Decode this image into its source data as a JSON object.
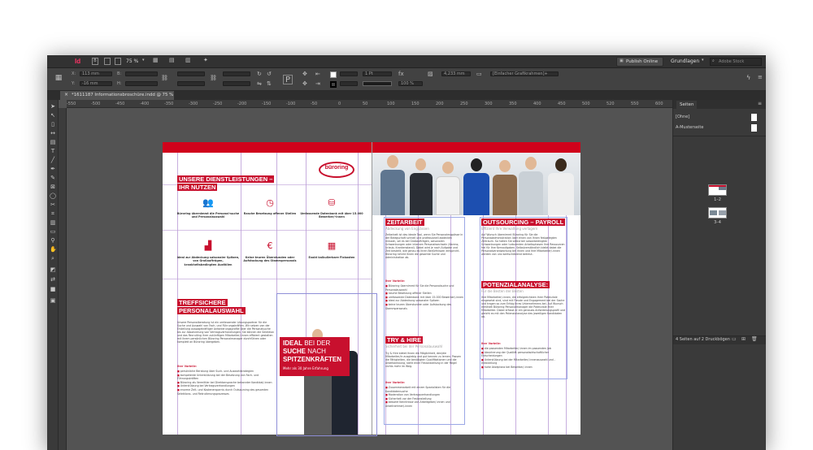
{
  "app": {
    "app_logo": "Id",
    "zoom": "75 %",
    "publish_label": "Publish Online",
    "workspace": "Grundlagen",
    "search_placeholder": "Adobe Stock"
  },
  "control_bar": {
    "x_value": "113 mm",
    "y_value": "-16 mm",
    "stroke_weight": "1 Pt",
    "opacity": "100 %",
    "size_value": "4,233 mm",
    "frame_style": "[Einfacher Grafikrahmen]+"
  },
  "document_tab": {
    "title": "*1611187 Informationsbroschüre.indd @ 75 %",
    "close": "×"
  },
  "ruler": {
    "ticks": [
      "-550",
      "-500",
      "-450",
      "-400",
      "-350",
      "-300",
      "-250",
      "-200",
      "-150",
      "-100",
      "-50",
      "0",
      "50",
      "100",
      "150",
      "200",
      "250",
      "300",
      "350",
      "400",
      "450",
      "500",
      "520",
      "550",
      "600"
    ]
  },
  "pages_panel": {
    "tab_label": "Seiten",
    "none_master": "[Ohne]",
    "a_master": "A-Musterseite",
    "spread1_label": "1–2",
    "spread2_label": "3–4",
    "status": "4 Seiten auf 2 Druckbögen"
  },
  "left_page": {
    "logo": "büroring",
    "services_heading_1": "UNSERE DIENSTLEISTUNGEN –",
    "services_heading_2": "IHR NUTZEN",
    "services": [
      {
        "icon": "people-icon",
        "text": "Büroring übernimmt die Personal-suche und Personalauswahl"
      },
      {
        "icon": "clock-icon",
        "text": "Rasche Besetzung offener Stellen"
      },
      {
        "icon": "database-icon",
        "text": "Umfassende Datenbank mit über 15.000 Bewerber/-innen"
      },
      {
        "icon": "bar-chart-icon",
        "text": "Ideal zur Abdeckung saisonaler Spitzen, von Großaufträgen, krankheitsbedingten Ausfällen"
      },
      {
        "icon": "no-euro-icon",
        "text": "Keine teuren Überstunden oder Aufstockung des Stammpersonals"
      },
      {
        "icon": "calculator-icon",
        "text": "Exakt kalkulierbare Fixkosten"
      }
    ],
    "selection_heading_1": "TREFFSICHERE",
    "selection_heading_2": "PERSONALAUSWAHL",
    "selection_body": "Unsere Personalberatung ist ein umfassender Lösungspartner für die Suche und Auswahl von Fach- und Führungskräften. Wir setzen von der Erstellung aussagekräftiger Anforderungsprofile über die Personalsuche bis zur Absolvierung von Vertragsverhandlungen. Sie können die Selektion und das Recruiting ihrer zukünftigen Mitarbeiter/-innen effizient gestalten mit ihrem persönlichen Büroring Personalmanager durchführen oder komplett an Büroring übergeben.",
    "vorteil_label": "Ihre Vorteile:",
    "selection_bullets": [
      "persönliche Beratung über Such- und Auswahlstrategien",
      "kompetente Unterstützung bei der Besetzung von Fach- und Führungskräften",
      "Büroring als Vermittler bei Direktansprache bekannter Kandidat/-innen",
      "Unterstützung bei Vertragsverhandlungen",
      "enorme Zeit- und Kostenersparnis durch Outsourcing des gesamten Selektions- und Rekrutierungsprozesses"
    ],
    "banner_line1_strong": "IDEAL",
    "banner_line1_rest": " BEI DER",
    "banner_line2_strong": "SUCHE",
    "banner_line2_rest": " NACH",
    "banner_line3": "SPITZENKRÄFTEN",
    "banner_tag": "Mehr als 30 Jahre Erfahrung"
  },
  "right_page": {
    "zeitarbeit_heading": "ZEITARBEIT",
    "zeitarbeit_sub": "Abdeckung von Engpässen",
    "zeitarbeit_body": "Zeitarbeit ist das ideale Tool, wenn Sie Personalengpässe in der Belegschaft schnell und professionell abdecken müssen, sei es bei Großaufträgen, saisonalen Schwankungen oder internen Personalwechseln (Karenz, Urlaub, Krankenstand). Dabei wird je nach Aufgabe und Zeit bestellt, wie genau es Ihren Bedürfnissen entspricht. Büroring nimmt Ihnen die gesamte Suche und Administration ab.",
    "zeitarbeit_vorteil": "Ihre Vorteile:",
    "zeitarbeit_bullets": [
      "Büroring übernimmt für Sie die Personalsuche und Personalauswahl",
      "rasche Besetzung offener Stellen",
      "umfassende Datenbank mit über 15.000 Bewerber/-innen",
      "ideal zur Abdeckung saisonaler Spitzen",
      "keine teuren Überstunden oder Aufstockung des Stammpersonals"
    ],
    "tryhire_heading": "TRY & HIRE",
    "tryhire_sub": "Sicherheit bei der Personalauswahl",
    "tryhire_body": "Try & Hire bietet Ihnen die Möglichkeit, den/die Mitarbeiter/in ausgiebig und gut kennen zu lernen. Passen die Fähigkeiten, die benötigten Qualifikationen und die Arbeitsleistung, steht einer Festanstellung in der Regel nichts mehr im Weg.",
    "tryhire_vorteil": "Ihre Vorteile:",
    "tryhire_bullets": [
      "Zusammenarbeit mit einem Spezialisten für die Kandidatensuche",
      "Moderation von Vertragsverhandlungen",
      "Sicherheit vor der Festanstellung",
      "bessere Kenntnisse von Arbeitgeber/-innen und Arbeitnehmer/-innen"
    ],
    "outsourcing_heading": "OUTSOURCING – PAYROLL",
    "outsourcing_sub": "Effizient Ihre Verwaltung verlagern",
    "outsourcing_body": "Auf Wunsch übernimmt Büroring für Sie die Personaladministration über einen von Ihnen festgelegten Zeitraum. So halten Sie selbst bei saisonbedingten Schwankungen oder turbulenten Arbeitsphasen Ihre Ressourcen frei für Ihre Kernaufgaben. Selbstverständlich bleibt dabei die Personalverantwortung bei Ihnen und Ihre Mitarbeiter/-innen werden von uns wertschätzend betreut.",
    "potenzial_heading": "POTENZIALANALYSE:",
    "potenzial_sub": "Für die Besten der Besten",
    "potenzial_body": "Ihre Mitarbeiter/-innen, die erfolgreichsten ihrer Potenziale eingesetzt sind, sind mit Freude und Engagement bei der Sache und tragen so zum Erfolg Ihres Unternehmens bei. Auf Wunsch ermittelt Büroring Personalmanager die Potenziale Ihrer Mitarbeiter. Dabei erfasst er ein genaues Anforderungsprofil und gleicht es mit den Potenzialanalyse des jeweiligen Kandidaten ab.",
    "potenzial_vorteil": "Ihre Vorteile:",
    "potenzial_bullets": [
      "die passenden Mitarbeiter/-innen im passenden Job",
      "Absicherung der Qualität personalwirtschaftlicher Entscheidungen",
      "Unterstützung bei der Mitarbeiter/-innenauswahl und -entwicklung",
      "hohe Akzeptanz bei Bewerber/-innen"
    ]
  }
}
